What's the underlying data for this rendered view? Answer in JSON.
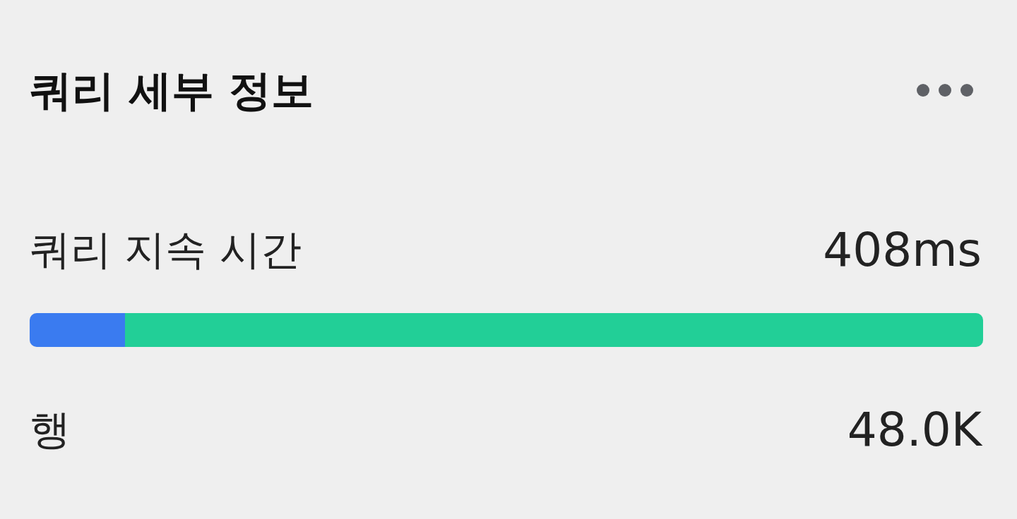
{
  "panel": {
    "title": "쿼리 세부 정보"
  },
  "metrics": [
    {
      "kind": "bar",
      "label": "쿼리 지속 시간",
      "value": "408ms",
      "segments": [
        {
          "color": "#3a7bf0",
          "level": 0.1
        },
        {
          "color": "#22cf97",
          "level": 0.9
        }
      ]
    },
    {
      "kind": "plain",
      "label": "행",
      "value": "48.0K"
    }
  ]
}
